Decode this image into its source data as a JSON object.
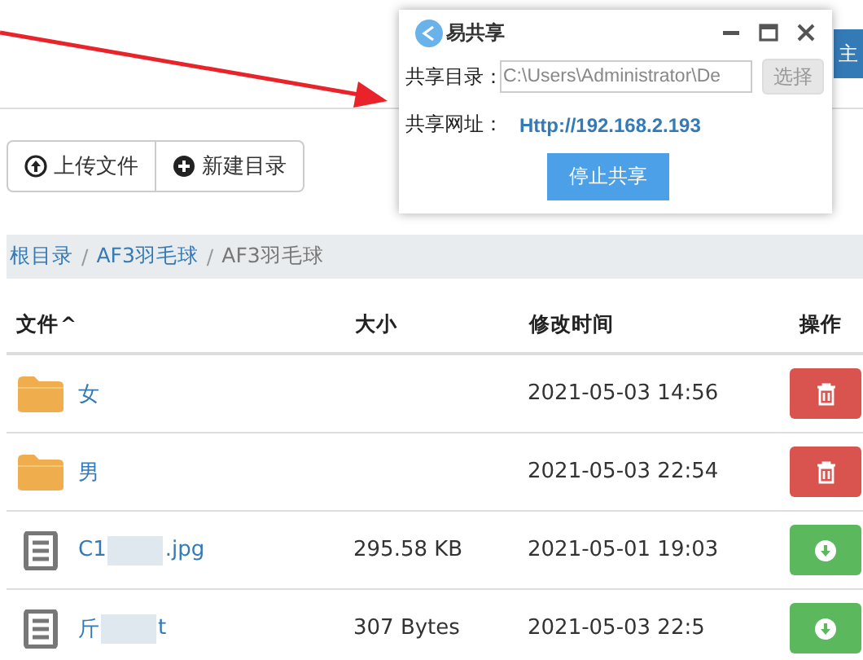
{
  "topbar": {
    "home_button": "主"
  },
  "dialog": {
    "title": "易共享",
    "dir_label": "共享目录：",
    "dir_value": "C:\\Users\\Administrator\\De",
    "select_button": "选择",
    "select_disabled": true,
    "url_label": "共享网址：",
    "url": "Http://192.168.2.193",
    "stop_button": "停止共享"
  },
  "toolbar": [
    {
      "label": "上传文件",
      "kind": "upload"
    },
    {
      "label": "新建目录",
      "kind": "new"
    }
  ],
  "breadcrumb_separator": "/",
  "breadcrumb": [
    {
      "label": "根目录",
      "link": true
    },
    {
      "label": "AF3羽毛球",
      "link": true
    },
    {
      "label": "AF3羽毛球",
      "link": false
    }
  ],
  "table": {
    "columns": [
      "文件",
      "大小",
      "修改时间",
      "操作"
    ],
    "sort_icon": "^",
    "rows": [
      {
        "kind": "folder",
        "name_start": "女",
        "blurred": false,
        "modified": "2021-05-03 14:56",
        "action": {
          "kind": "delete"
        }
      },
      {
        "kind": "folder",
        "name_start": "男",
        "blurred": false,
        "modified": "2021-05-03 22:54",
        "action": {
          "kind": "delete"
        }
      },
      {
        "kind": "file",
        "name_start": "C1",
        "name_end": ".jpg",
        "blurred": true,
        "size": "295.58 KB",
        "modified": "2021-05-01 19:03",
        "action": {
          "kind": "download"
        }
      },
      {
        "kind": "file",
        "name_start": "斤",
        "name_end": "t",
        "blurred": true,
        "size": "307 Bytes",
        "modified": "2021-05-03 22:5",
        "action": {
          "kind": "download"
        }
      }
    ]
  }
}
